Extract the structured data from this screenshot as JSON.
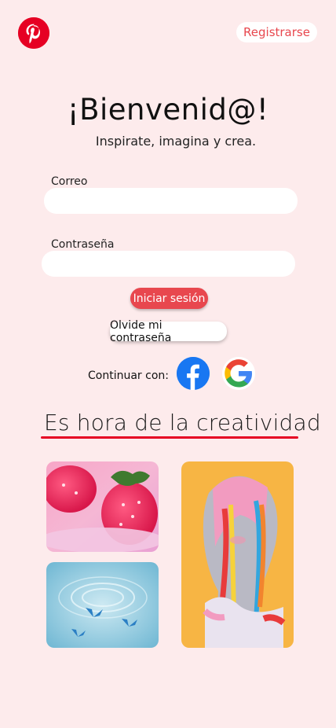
{
  "header": {
    "logo_icon": "pinterest-logo-icon",
    "register_label": "Registrarse"
  },
  "welcome": {
    "title": "¡Bienvenid@!",
    "subtitle": "Inspirate, imagina y crea."
  },
  "form": {
    "email_label": "Correo",
    "email_value": "",
    "password_label": "Contraseña",
    "password_value": "",
    "login_label": "Iniciar sesión",
    "forgot_label": "Olvide mi contraseña"
  },
  "social": {
    "continue_label": "Continuar con:",
    "facebook_icon": "facebook-icon",
    "google_icon": "google-icon"
  },
  "gallery": {
    "headline": "Es hora de la creatividad",
    "images": [
      {
        "name": "strawberries-image"
      },
      {
        "name": "water-butterflies-image"
      },
      {
        "name": "melting-face-image"
      }
    ]
  },
  "colors": {
    "accent": "#e8474e",
    "brand": "#e60023",
    "background": "#fdebec"
  }
}
